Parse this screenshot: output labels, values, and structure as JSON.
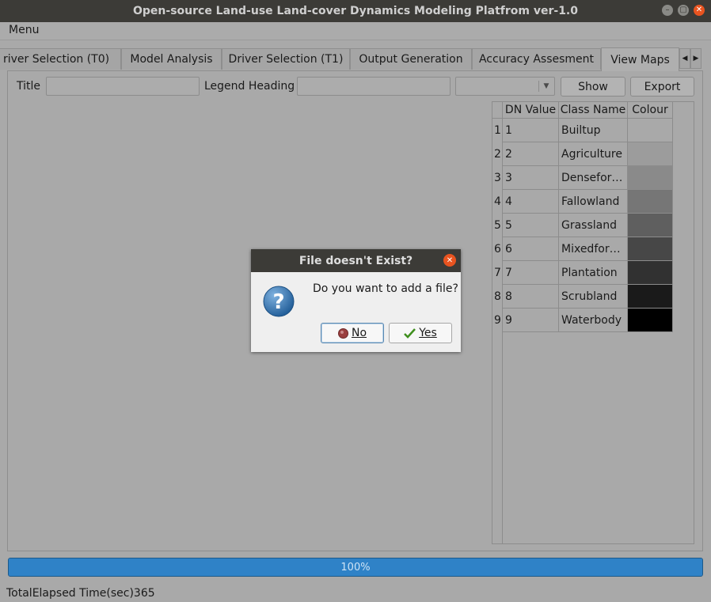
{
  "window": {
    "title": "Open-source Land-use Land-cover Dynamics Modeling Platfrom ver-1.0"
  },
  "menubar": {
    "menu_label": "Menu"
  },
  "tabs": [
    {
      "label": "river Selection (T0)"
    },
    {
      "label": "Model Analysis"
    },
    {
      "label": "Driver Selection (T1)"
    },
    {
      "label": "Output Generation"
    },
    {
      "label": "Accuracy Assesment"
    },
    {
      "label": "View Maps",
      "active": true
    }
  ],
  "toolbar": {
    "title_label": "Title",
    "title_value": "",
    "legend_label": "Legend Heading",
    "legend_value": "",
    "combo_value": "",
    "show_label": "Show",
    "export_label": "Export"
  },
  "table": {
    "headers": [
      "DN Value",
      "Class Name",
      "Colour"
    ],
    "rows": [
      {
        "n": "1",
        "dn": "1",
        "name": "Builtup",
        "colour": "#a9a9a9"
      },
      {
        "n": "2",
        "dn": "2",
        "name": "Agriculture",
        "colour": "#9c9c9c"
      },
      {
        "n": "3",
        "dn": "3",
        "name": "Densefor…",
        "colour": "#8a8a8a"
      },
      {
        "n": "4",
        "dn": "4",
        "name": "Fallowland",
        "colour": "#767676"
      },
      {
        "n": "5",
        "dn": "5",
        "name": "Grassland",
        "colour": "#5f5f5f"
      },
      {
        "n": "6",
        "dn": "6",
        "name": "Mixedfor…",
        "colour": "#474747"
      },
      {
        "n": "7",
        "dn": "7",
        "name": "Plantation",
        "colour": "#313131"
      },
      {
        "n": "8",
        "dn": "8",
        "name": "Scrubland",
        "colour": "#1a1a1a"
      },
      {
        "n": "9",
        "dn": "9",
        "name": "Waterbody",
        "colour": "#000000"
      }
    ]
  },
  "progress": {
    "value": 1.0,
    "text": "100%"
  },
  "status": {
    "text": "TotalElapsed Time(sec)365"
  },
  "dialog": {
    "title": "File doesn't Exist?",
    "message": "Do you want to add a file?",
    "no_label": "No",
    "yes_label": "Yes",
    "icon": "question-icon"
  }
}
